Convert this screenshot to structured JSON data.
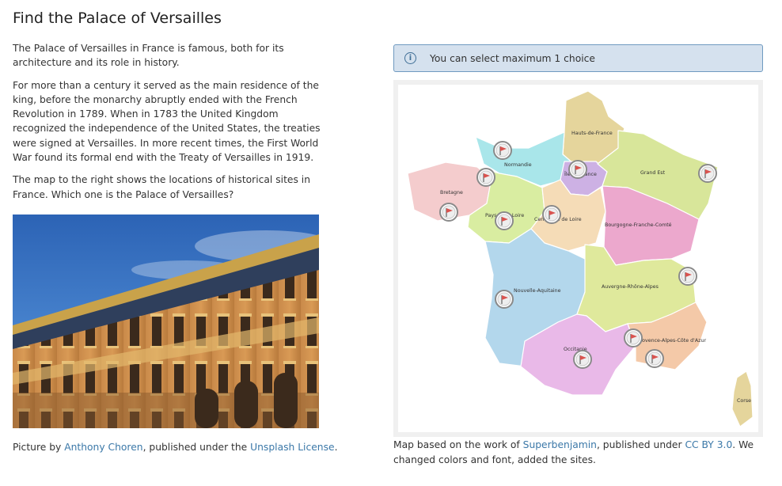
{
  "page": {
    "title": "Find the Palace of Versailles",
    "paragraphs": [
      "The Palace of Versailles in France is famous, both for its architecture and its role in history.",
      "For more than a century it served as the main residence of the king, before the monarchy abruptly ended with the French Revolution in 1789. When in 1783 the United Kingdom recognized the independence of the United States, the treaties were signed at Versailles. In more recent times, the First World War found its formal end with the Treaty of Versailles in 1919.",
      "The map to the right shows the locations of historical sites in France. Which one is the Palace of Versailles?"
    ]
  },
  "photo_caption": {
    "prefix": "Picture by ",
    "author": "Anthony Choren",
    "middle": ", published under the ",
    "license": "Unsplash License",
    "suffix": "."
  },
  "notice": {
    "text": "You can select maximum 1 choice",
    "icon": "info-icon"
  },
  "map": {
    "regions": {
      "hdf": "Hauts-de-France",
      "nor": "Normandie",
      "idf": "Île-de-France",
      "ge": "Grand Est",
      "bre": "Bretagne",
      "pdl": "Pays de la Loire",
      "cvl": "Centre-Val de Loire",
      "bfc": "Bourgogne-Franche-Comté",
      "na": "Nouvelle-Aquitaine",
      "ara": "Auvergne-Rhône-Alpes",
      "occ": "Occitanie",
      "paca": "Provence-Alpes-Côte d'Azur",
      "cor": "Corse"
    },
    "site_icon": "flag-icon"
  },
  "map_caption": {
    "prefix": "Map based on the work of ",
    "author": "Superbenjamin",
    "middle": ", published under ",
    "license": "CC BY 3.0",
    "suffix": ". We changed colors and font, added the sites."
  },
  "colors": {
    "hdf": "#e5d59c",
    "nor": "#a9e6ea",
    "idf": "#cdb1e4",
    "ge": "#d8e69a",
    "bre": "#f4cccd",
    "pdl": "#d9eda1",
    "cvl": "#f5dcb7",
    "bfc": "#eca8cd",
    "na": "#b3d7ec",
    "ara": "#dfe99c",
    "occ": "#e9b9e8",
    "paca": "#f4c9a8",
    "cor": "#e5d59c",
    "link": "#3b78a8",
    "notice_bg": "#d5e1ee"
  }
}
